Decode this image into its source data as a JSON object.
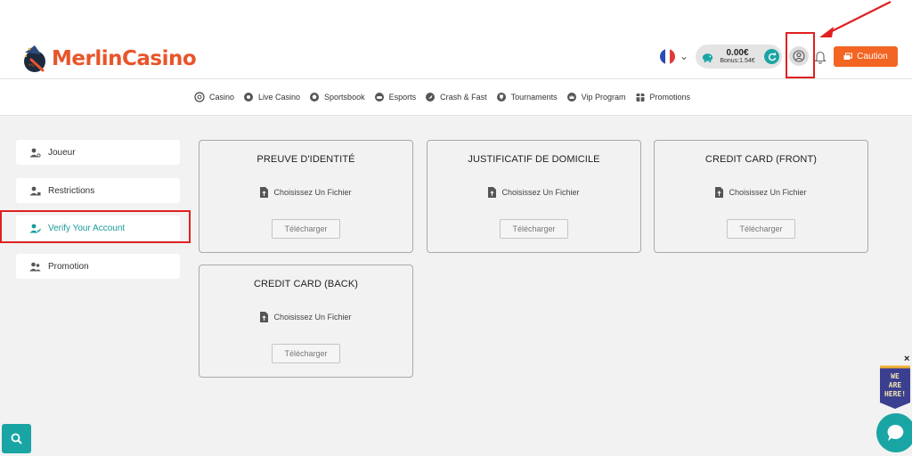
{
  "brand": {
    "logo_text_a": "Merlin",
    "logo_text_b": "Casino",
    "accent_color": "#f26522",
    "teal_color": "#1aa5a5"
  },
  "header": {
    "language": "fr",
    "balance": "0.00€",
    "bonus": "Bonus:1.54€",
    "caution_label": "Caution"
  },
  "nav": {
    "items": [
      {
        "label": "Casino",
        "icon": "casino-chip-icon"
      },
      {
        "label": "Live Casino",
        "icon": "live-icon"
      },
      {
        "label": "Sportsbook",
        "icon": "ball-icon"
      },
      {
        "label": "Esports",
        "icon": "controller-icon"
      },
      {
        "label": "Crash & Fast",
        "icon": "rocket-icon"
      },
      {
        "label": "Tournaments",
        "icon": "trophy-icon"
      },
      {
        "label": "Vip Program",
        "icon": "crown-icon"
      },
      {
        "label": "Promotions",
        "icon": "gift-icon"
      }
    ]
  },
  "sidebar": {
    "items": [
      {
        "label": "Joueur",
        "icon": "user-icon"
      },
      {
        "label": "Restrictions",
        "icon": "user-lock-icon"
      },
      {
        "label": "Verify Your Account",
        "icon": "user-check-icon",
        "active": true
      },
      {
        "label": "Promotion",
        "icon": "users-icon"
      }
    ]
  },
  "documents": {
    "choose_label": "Choisissez Un Fichier",
    "upload_label": "Télécharger",
    "cards": [
      {
        "title": "PREUVE D'IDENTITÉ"
      },
      {
        "title": "JUSTIFICATIF DE DOMICILE"
      },
      {
        "title": "CREDIT CARD (FRONT)"
      },
      {
        "title": "CREDIT CARD (BACK)"
      }
    ]
  },
  "widgets": {
    "we_here_line1": "WE",
    "we_here_line2": "ARE",
    "we_here_line3": "HERE!",
    "close_glyph": "×"
  }
}
